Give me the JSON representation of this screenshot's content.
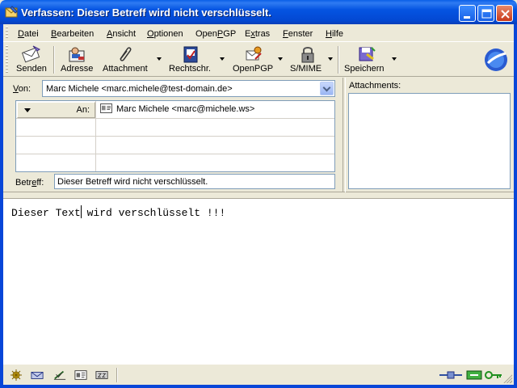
{
  "window": {
    "title": "Verfassen: Dieser Betreff wird nicht verschlüsselt."
  },
  "menu": {
    "items": [
      {
        "pre": "",
        "u": "D",
        "post": "atei"
      },
      {
        "pre": "",
        "u": "B",
        "post": "earbeiten"
      },
      {
        "pre": "",
        "u": "A",
        "post": "nsicht"
      },
      {
        "pre": "",
        "u": "O",
        "post": "ptionen"
      },
      {
        "pre": "Open",
        "u": "P",
        "post": "GP"
      },
      {
        "pre": "E",
        "u": "x",
        "post": "tras"
      },
      {
        "pre": "",
        "u": "F",
        "post": "enster"
      },
      {
        "pre": "",
        "u": "H",
        "post": "ilfe"
      }
    ]
  },
  "toolbar": {
    "send": "Senden",
    "address": "Adresse",
    "attachment": "Attachment",
    "spelling": "Rechtschr.",
    "openpgp": "OpenPGP",
    "smime": "S/MIME",
    "save": "Speichern"
  },
  "header": {
    "from_label_u": "V",
    "from_label_rest": "on:",
    "from_value": "Marc Michele <marc.michele@test-domain.de>",
    "recipient_type": "An:",
    "recipient_value": "Marc Michele <marc@michele.ws>",
    "subject_label_pre": "Betr",
    "subject_label_u": "e",
    "subject_label_post": "ff:",
    "subject_value": "Dieser Betreff wird nicht verschlüsselt.",
    "attachments_label": "Attachments:"
  },
  "body": {
    "text": "Dieser Text wird verschlüsselt !!!"
  },
  "colors": {
    "titlebar": "#0554e2",
    "face": "#ece9d8"
  }
}
